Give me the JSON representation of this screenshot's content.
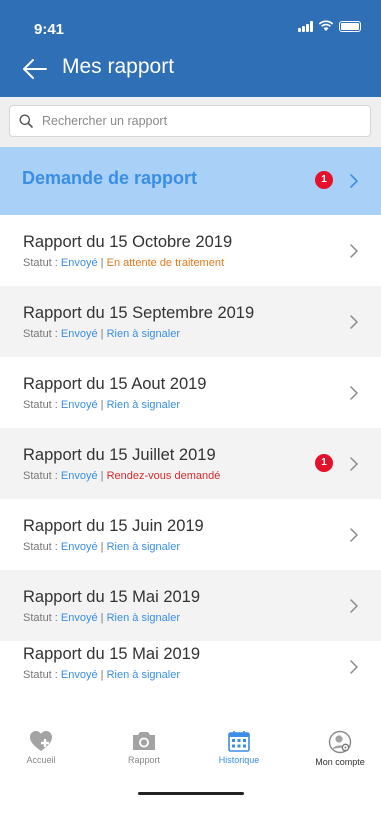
{
  "status_bar": {
    "time": "9:41"
  },
  "header": {
    "title": "Mes rapport"
  },
  "search": {
    "placeholder": "Rechercher un rapport"
  },
  "request": {
    "label": "Demande de rapport",
    "badge": "1"
  },
  "reports": [
    {
      "title": "Rapport du 15 Octobre 2019",
      "status_prefix": "Statut : ",
      "sent": "Envoyé",
      "separator": " | ",
      "state": "En attente de traitement",
      "state_color": "orange",
      "badge": ""
    },
    {
      "title": "Rapport du 15 Septembre 2019",
      "status_prefix": "Statut : ",
      "sent": "Envoyé",
      "separator": " | ",
      "state": "Rien à signaler",
      "state_color": "blue",
      "badge": ""
    },
    {
      "title": "Rapport du 15 Aout 2019",
      "status_prefix": "Statut : ",
      "sent": "Envoyé",
      "separator": " | ",
      "state": "Rien à signaler",
      "state_color": "blue",
      "badge": ""
    },
    {
      "title": "Rapport du 15 Juillet 2019",
      "status_prefix": "Statut : ",
      "sent": "Envoyé",
      "separator": " | ",
      "state": "Rendez-vous demandé",
      "state_color": "red",
      "badge": "1"
    },
    {
      "title": "Rapport du 15 Juin 2019",
      "status_prefix": "Statut : ",
      "sent": "Envoyé",
      "separator": " | ",
      "state": "Rien à signaler",
      "state_color": "blue",
      "badge": ""
    },
    {
      "title": "Rapport du 15 Mai 2019",
      "status_prefix": "Statut : ",
      "sent": "Envoyé",
      "separator": " | ",
      "state": "Rien à signaler",
      "state_color": "blue",
      "badge": ""
    },
    {
      "title": "Rapport du 15 Mai 2019",
      "status_prefix": "Statut : ",
      "sent": "Envoyé",
      "separator": " | ",
      "state": "Rien à signaler",
      "state_color": "blue",
      "badge": ""
    }
  ],
  "tabbar": {
    "items": [
      {
        "label": "Accueil",
        "icon": "heart-plus-icon",
        "active": false
      },
      {
        "label": "Rapport",
        "icon": "camera-icon",
        "active": false
      },
      {
        "label": "Historique",
        "icon": "calendar-icon",
        "active": true
      },
      {
        "label": "Mon compte",
        "icon": "user-gear-icon",
        "active": false
      }
    ]
  },
  "colors": {
    "header": "#2f6fb5",
    "accent": "#3a8ee6",
    "request_bg": "#a9d0f7",
    "badge": "#e5112a",
    "orange": "#e07b1e",
    "red": "#d62b2b"
  }
}
